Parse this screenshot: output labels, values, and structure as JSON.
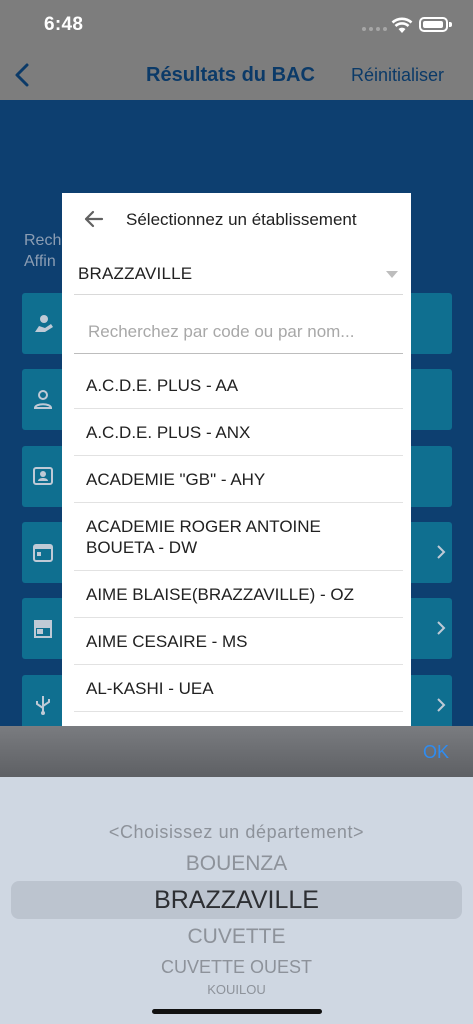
{
  "status": {
    "time": "6:48"
  },
  "nav": {
    "title": "Résultats du BAC",
    "reset_label": "Réinitialiser"
  },
  "background": {
    "text_line1": "Rech",
    "text_line2": "Affin"
  },
  "modal": {
    "title": "Sélectionnez un établissement",
    "department": "BRAZZAVILLE",
    "search_placeholder": "Recherchez par code ou par nom...",
    "schools": [
      "A.C.D.E. PLUS - AA",
      "A.C.D.E. PLUS - ANX",
      "ACADEMIE \"GB\" - AHY",
      "ACADEMIE ROGER ANTOINE BOUETA - DW",
      "AIME BLAISE(BRAZZAVILLE) - OZ",
      "AIME CESAIRE - MS",
      "AL-KASHI - UEA"
    ]
  },
  "picker": {
    "ok_label": "OK",
    "options": [
      "<Choisissez un département>",
      "BOUENZA",
      "BRAZZAVILLE",
      "CUVETTE",
      "CUVETTE OUEST",
      "KOUILOU"
    ],
    "selected": "BRAZZAVILLE"
  },
  "colors": {
    "accent": "#2f8cf0",
    "brand_dark": "#0b3a68",
    "teal": "#0f6f90"
  }
}
